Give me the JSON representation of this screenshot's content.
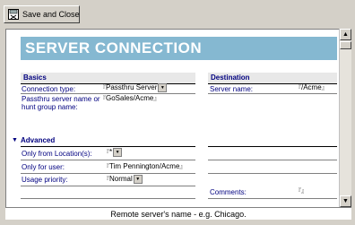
{
  "toolbar": {
    "save_close_label": "Save and Close"
  },
  "form": {
    "title": "SERVER CONNECTION",
    "basics": {
      "header": "Basics",
      "connection_type": {
        "label": "Connection type:",
        "value": "Passthru Server"
      },
      "server_name_hunt": {
        "label": "Passthru server name or hunt group name:",
        "value": "GoSales/Acme"
      }
    },
    "destination": {
      "header": "Destination",
      "server_name": {
        "label": "Server name:",
        "value": "/Acme"
      }
    },
    "advanced": {
      "header": "Advanced",
      "only_from_location": {
        "label": "Only from Location(s):",
        "value": "*"
      },
      "only_for_user": {
        "label": "Only for user:",
        "value": "Tim Pennington/Acme"
      },
      "usage_priority": {
        "label": "Usage priority:",
        "value": "Normal"
      },
      "comments": {
        "label": "Comments:",
        "value": ""
      }
    }
  },
  "hint": {
    "text": "Remote server's name - e.g. Chicago."
  },
  "colors": {
    "banner": "#85b8d1",
    "label": "#000080",
    "toolbar": "#d4d0c8"
  }
}
